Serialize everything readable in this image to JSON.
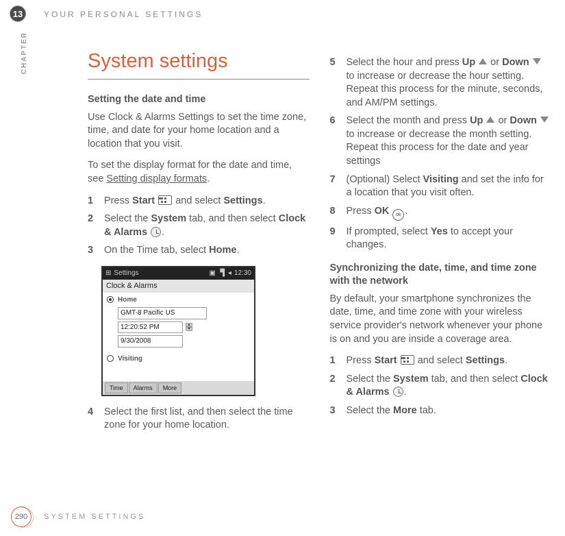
{
  "chapter_number": "13",
  "chapter_label": "CHAPTER",
  "header_title": "YOUR PERSONAL SETTINGS",
  "main_title": "System settings",
  "page_number": "290",
  "footer_title": "SYSTEM SETTINGS",
  "left": {
    "section1_head": "Setting the date and time",
    "intro": "Use Clock & Alarms Settings to set the time zone, time, and date for your home location and a location that you visit.",
    "format_prefix": "To set the display format for the date and time, see ",
    "format_link": "Setting display formats",
    "format_suffix": ".",
    "s1_a": "Press ",
    "s1_b": "Start",
    "s1_c": " and select ",
    "s1_d": "Settings",
    "s1_e": ".",
    "s2_a": "Select the ",
    "s2_b": "System",
    "s2_c": " tab, and then select ",
    "s2_d": "Clock & Alarms",
    "s2_e": ".",
    "s3_a": "On the Time tab, select ",
    "s3_b": "Home",
    "s3_c": ".",
    "s4": "Select the first list, and then select the time zone for your home location."
  },
  "shot": {
    "bar_label": "Settings",
    "bar_time": "12:30",
    "panel_title": "Clock & Alarms",
    "home_label": "Home",
    "visiting_label": "Visiting",
    "tz": "GMT-8 Pacific US",
    "time": "12:20:52 PM",
    "date": "9/30/2008",
    "tab1": "Time",
    "tab2": "Alarms",
    "tab3": "More"
  },
  "right": {
    "s5_a": "Select the hour and press ",
    "s5_b": "Up",
    "s5_c": " or ",
    "s5_d": "Down",
    "s5_e": " to increase or decrease the hour setting. Repeat this process for the minute, seconds, and AM/PM settings.",
    "s6_a": "Select the month and press ",
    "s6_b": "Up",
    "s6_c": " or ",
    "s6_d": "Down",
    "s6_e": " to increase or decrease the month setting. Repeat this process for the date and year settings",
    "s7_a": "(Optional) Select ",
    "s7_b": "Visiting",
    "s7_c": " and set the info for a location that you visit often.",
    "s8_a": "Press ",
    "s8_b": "OK",
    "s8_c": ".",
    "s9_a": "If prompted, select ",
    "s9_b": "Yes",
    "s9_c": " to accept your changes.",
    "section2_head": "Synchronizing the date, time, and time zone with the network",
    "sync_intro": "By default, your smartphone synchronizes the date, time, and time zone with your wireless service provider's network whenever your phone is on and you are inside a coverage area.",
    "b1_a": "Press ",
    "b1_b": "Start",
    "b1_c": " and select ",
    "b1_d": "Settings",
    "b1_e": ".",
    "b2_a": "Select the ",
    "b2_b": "System",
    "b2_c": " tab, and then select ",
    "b2_d": "Clock & Alarms",
    "b2_e": ".",
    "b3_a": "Select the ",
    "b3_b": "More",
    "b3_c": " tab."
  }
}
